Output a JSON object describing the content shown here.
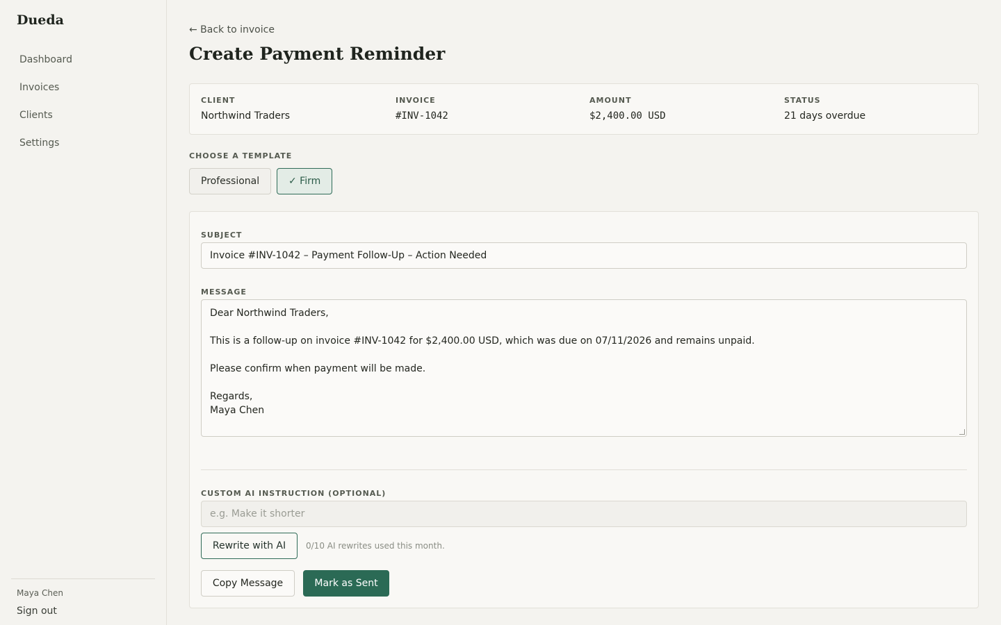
{
  "app": {
    "brand": "Dueda"
  },
  "sidebar": {
    "items": [
      {
        "label": "Dashboard"
      },
      {
        "label": "Invoices"
      },
      {
        "label": "Clients"
      },
      {
        "label": "Settings"
      }
    ],
    "user_name": "Maya Chen",
    "sign_out": "Sign out"
  },
  "header": {
    "back_link": "← Back to invoice",
    "title": "Create Payment Reminder"
  },
  "summary": {
    "client_label": "CLIENT",
    "client_value": "Northwind Traders",
    "invoice_label": "INVOICE",
    "invoice_value": "#INV-1042",
    "amount_label": "AMOUNT",
    "amount_value": "$2,400.00 USD",
    "status_label": "STATUS",
    "status_value": "21 days overdue"
  },
  "templates": {
    "label": "CHOOSE A TEMPLATE",
    "options": [
      {
        "label": "Professional",
        "selected": false
      },
      {
        "label": "✓ Firm",
        "selected": true
      }
    ]
  },
  "editor": {
    "subject_label": "SUBJECT",
    "subject_value": "Invoice #INV-1042 – Payment Follow-Up – Action Needed",
    "message_label": "MESSAGE",
    "message_lines": [
      "Dear Northwind Traders,",
      "",
      "This is a follow-up on invoice #INV-1042 for $2,400.00 USD, which was due on 07/11/2026 and remains unpaid.",
      "",
      "Please confirm when payment will be made.",
      "",
      "Regards,",
      "Maya Chen"
    ],
    "ai_label": "CUSTOM AI INSTRUCTION (OPTIONAL)",
    "ai_placeholder": "e.g. Make it shorter",
    "ai_value": "",
    "rewrite_button": "Rewrite with AI",
    "ai_usage": "0/10 AI rewrites used this month.",
    "copy_button": "Copy Message",
    "mark_sent_button": "Mark as Sent"
  },
  "colors": {
    "accent": "#2b6a55",
    "background": "#f4f3ef",
    "card": "#f9f8f5",
    "selected_template_bg": "#e3ece6"
  },
  "icons": {
    "back": "arrow-left-icon",
    "check": "check-icon",
    "resize": "resize-grip-icon"
  }
}
